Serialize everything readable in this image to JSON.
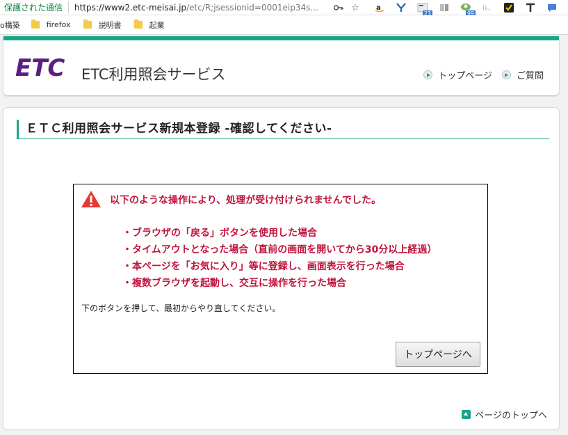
{
  "browser": {
    "secure_label": "保護された通信",
    "url_host": "https://www2.etc-meisai.jp",
    "url_path": "/etc/R;jsessionid=0001eip34s...",
    "badge_23": "23",
    "badge_99": "99"
  },
  "bookmarks": [
    {
      "label": "o構築"
    },
    {
      "label": "firefox"
    },
    {
      "label": "説明書"
    },
    {
      "label": "起業"
    }
  ],
  "header": {
    "logo_text": "ETC",
    "service_name": "ETC利用照会サービス",
    "nav": [
      {
        "label": "トップページ"
      },
      {
        "label": "ご質問"
      }
    ]
  },
  "main": {
    "title": "ＥＴＣ利用照会サービス新規本登録 -確認してください-",
    "error": {
      "heading": "以下のような操作により、処理が受け付けられませんでした。",
      "items": [
        "・ブラウザの「戻る」ボタンを使用した場合",
        "・タイムアウトとなった場合（直前の画面を開いてから30分以上経過）",
        "・本ページを「お気に入り」等に登録し、画面表示を行った場合",
        "・複数ブラウザを起動し、交互に操作を行った場合"
      ],
      "instruction": "下のボタンを押して、最初からやり直してください。",
      "button_label": "トップページへ"
    },
    "page_top_label": "ページのトップへ"
  },
  "colors": {
    "accent": "#1aa58a",
    "error": "#c0143c",
    "logo": "#5b1e83"
  },
  "icons": [
    "key-icon",
    "star-icon",
    "amazon-icon",
    "y-icon",
    "ext-23-icon",
    "ext-gray-icon",
    "ext-99-icon",
    "rw-icon",
    "check-icon",
    "t-icon",
    "chat-icon",
    "warning-icon"
  ]
}
